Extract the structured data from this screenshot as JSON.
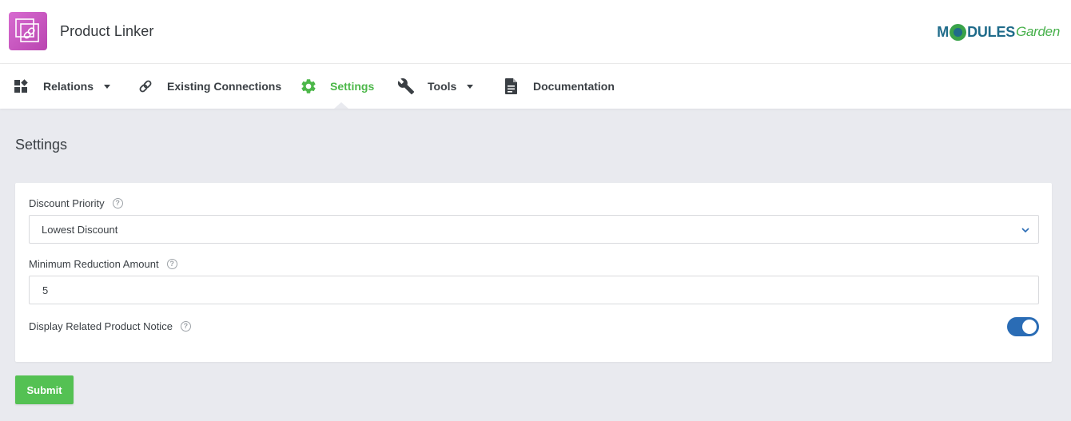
{
  "app": {
    "title": "Product Linker",
    "icon": "link-icon",
    "brand_primary": "M",
    "brand_rest": "DULES",
    "brand_secondary": "Garden"
  },
  "nav": {
    "items": [
      {
        "label": "Relations",
        "icon": "widgets-icon",
        "has_dropdown": true,
        "active": false
      },
      {
        "label": "Existing Connections",
        "icon": "link-icon",
        "has_dropdown": false,
        "active": false
      },
      {
        "label": "Settings",
        "icon": "gear-icon",
        "has_dropdown": false,
        "active": true
      },
      {
        "label": "Tools",
        "icon": "wrench-icon",
        "has_dropdown": true,
        "active": false
      },
      {
        "label": "Documentation",
        "icon": "document-icon",
        "has_dropdown": false,
        "active": false
      }
    ]
  },
  "page": {
    "title": "Settings"
  },
  "form": {
    "discount_priority": {
      "label": "Discount Priority",
      "value": "Lowest Discount"
    },
    "minimum_reduction": {
      "label": "Minimum Reduction Amount",
      "value": "5"
    },
    "related_notice": {
      "label": "Display Related Product Notice",
      "enabled": true
    },
    "submit_label": "Submit"
  },
  "colors": {
    "accent_green": "#4cb749",
    "toggle_blue": "#2a6cb5",
    "app_icon": "#c457bb",
    "background": "#e9eaef"
  }
}
